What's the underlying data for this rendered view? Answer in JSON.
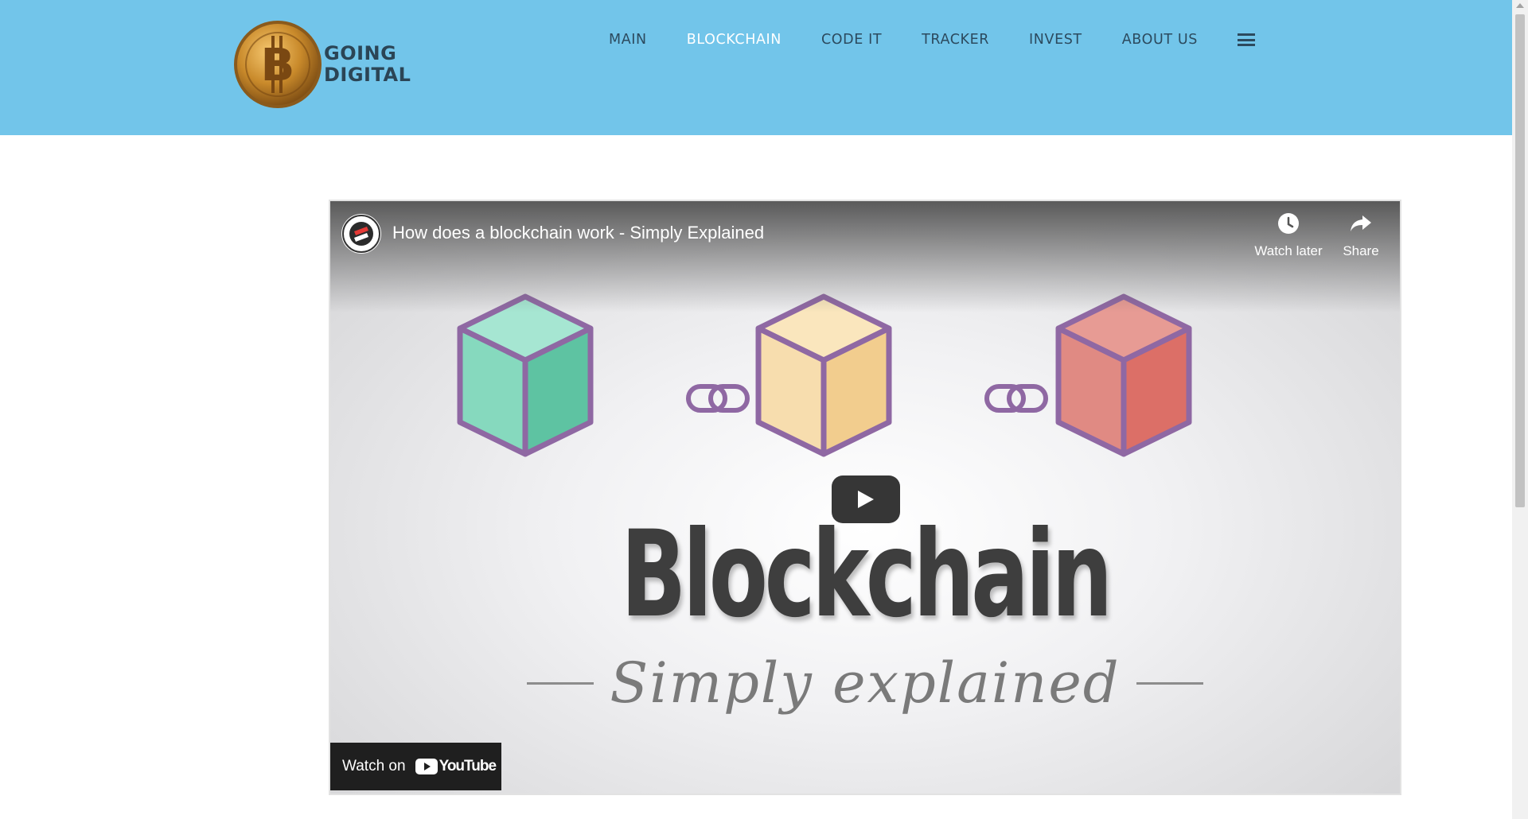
{
  "brand": {
    "line1": "GOING",
    "line2": "DIGITAL",
    "logo_icon": "bitcoin-coin-icon"
  },
  "nav": {
    "items": [
      {
        "label": "MAIN",
        "active": false
      },
      {
        "label": "BLOCKCHAIN",
        "active": true
      },
      {
        "label": "CODE IT",
        "active": false
      },
      {
        "label": "TRACKER",
        "active": false
      },
      {
        "label": "INVEST",
        "active": false
      },
      {
        "label": "ABOUT US",
        "active": false
      }
    ],
    "menu_icon": "hamburger-menu-icon"
  },
  "video": {
    "title": "How does a blockchain work - Simply Explained",
    "actions": {
      "watch_later": "Watch later",
      "share": "Share"
    },
    "thumbnail": {
      "headline": "Blockchain",
      "subline": "Simply explained"
    },
    "watch_on": {
      "label": "Watch on",
      "platform": "YouTube"
    }
  },
  "colors": {
    "header_bg": "#72c5ea",
    "nav_text": "#2c4a5e",
    "nav_active": "#ffffff",
    "cube_green": "#7fd9c0",
    "cube_yellow": "#f6dba0",
    "cube_red": "#e07f76",
    "cube_outline": "#8f68a3"
  }
}
